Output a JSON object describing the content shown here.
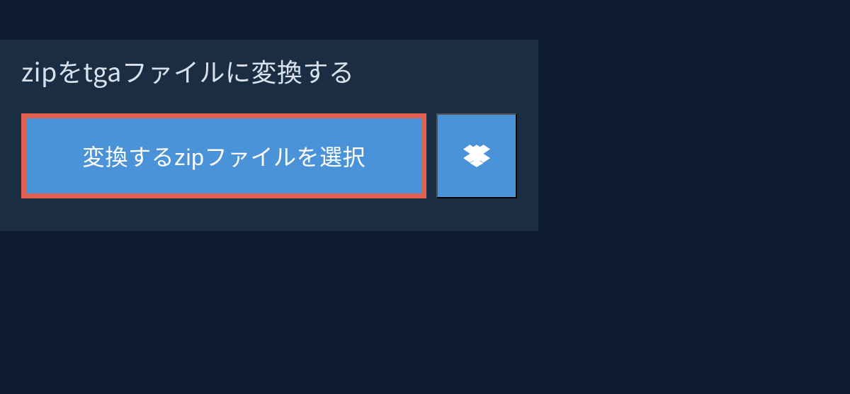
{
  "title": "zipをtgaファイルに変換する",
  "buttons": {
    "select_file": "変換するzipファイルを選択"
  }
}
